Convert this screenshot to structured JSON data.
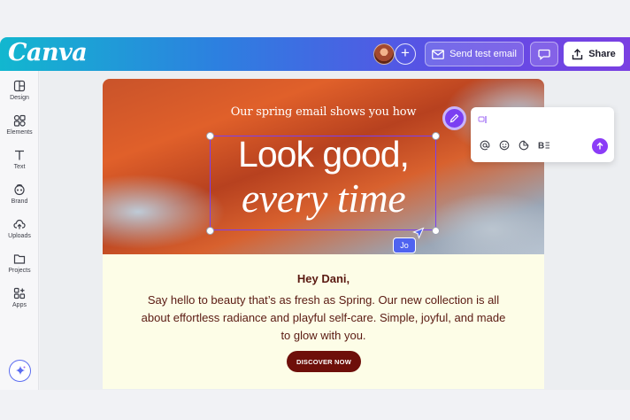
{
  "app": {
    "logo_text": "Canva"
  },
  "topbar": {
    "send_test_label": "Send test email",
    "share_label": "Share",
    "add_collaborator_symbol": "+"
  },
  "sidebar": {
    "items": [
      {
        "label": "Design",
        "icon": "layout-icon"
      },
      {
        "label": "Elements",
        "icon": "shapes-icon"
      },
      {
        "label": "Text",
        "icon": "text-icon"
      },
      {
        "label": "Brand",
        "icon": "brand-icon"
      },
      {
        "label": "Uploads",
        "icon": "cloud-upload-icon"
      },
      {
        "label": "Projects",
        "icon": "folder-icon"
      },
      {
        "label": "Apps",
        "icon": "apps-icon"
      }
    ],
    "magic_icon": "sparkle-icon"
  },
  "email": {
    "hero_subtitle": "Our spring email shows you how",
    "headline_line1": "Look good,",
    "headline_line2": "every time",
    "greeting": "Hey Dani,",
    "body": "Say hello to beauty that’s as fresh as Spring. Our new collection is all about effortless radiance and playful self-care. Simple, joyful, and made to glow with you.",
    "cta_label": "DISCOVER NOW"
  },
  "collaboration": {
    "cursor_user": "Jo"
  },
  "colors": {
    "accent_purple": "#7b3ff2",
    "email_text": "#5a1a12",
    "cta_bg": "#6e0f0a",
    "email_bg": "#fdfde7",
    "cursor_badge": "#4f63f0"
  }
}
